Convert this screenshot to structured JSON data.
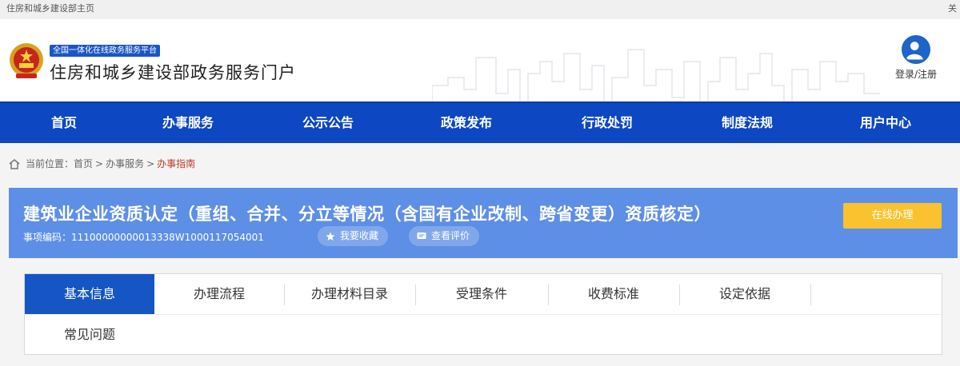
{
  "topbar": {
    "breadcrumb": "住房和城乡建设部主页",
    "right_text": "关"
  },
  "header": {
    "platform_tag": "全国一体化在线政务服务平台",
    "site_title": "住房和城乡建设部政务服务门户",
    "login_label": "登录/注册"
  },
  "nav": {
    "items": [
      "首页",
      "办事服务",
      "公示公告",
      "政策发布",
      "行政处罚",
      "制度法规",
      "用户中心"
    ]
  },
  "breadcrumb": {
    "prefix": "当前位置：",
    "home": "首页",
    "service": "办事服务",
    "current": "办事指南",
    "sep": ">"
  },
  "banner": {
    "title": "建筑业企业资质认定（重组、合并、分立等情况（含国有企业改制、跨省变更）资质核定）",
    "code_label": "事项编码：",
    "code_value": "11100000000013338W1000117054001",
    "favorite_label": "我要收藏",
    "review_label": "查看评价",
    "online_button": "在线办理"
  },
  "tabs": {
    "items": [
      "基本信息",
      "办理流程",
      "办理材料目录",
      "受理条件",
      "收费标准",
      "设定依据",
      "常见问题"
    ],
    "active_index": 0
  },
  "colors": {
    "nav_bg": "#0d47c1",
    "banner_bg": "#5e8fe6",
    "online_button": "#f9c22e",
    "active_tab": "#1656c4",
    "breadcrumb_current": "#c0392b"
  }
}
